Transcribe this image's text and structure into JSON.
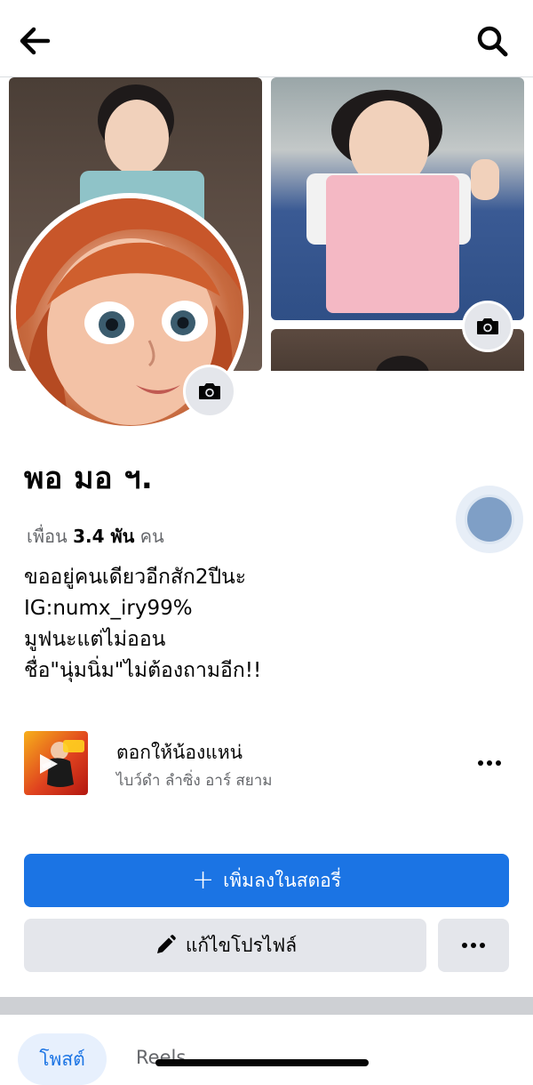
{
  "header": {
    "back_icon": "arrow-left-icon",
    "search_icon": "search-icon"
  },
  "cover": {
    "camera_icon": "camera-icon"
  },
  "profile": {
    "name": "พอ มอ ฯ.",
    "friends_prefix": "เพื่อน",
    "friends_count": "3.4 พัน",
    "friends_suffix": "คน",
    "bio": [
      "ขออยู่คนเดียวอีกสัก2ปีนะ",
      "IG:numx_iry99%",
      "มูฟนะแต่ไม่ออน",
      "ชื่อ\"นุ่มนิ่ม\"ไม่ต้องถามอีก!!"
    ]
  },
  "music": {
    "song": "ตอกให้น้องแหน่",
    "artist": "ไบว์ดำ ลำซิ่ง อาร์ สยาม",
    "play_icon": "play-icon",
    "more_icon": "more-horizontal-icon"
  },
  "actions": {
    "add_story": "เพิ่มลงในสตอรี่",
    "edit_profile": "แก้ไขโปรไฟล์"
  },
  "tabs": {
    "posts": "โพสต์",
    "reels": "Reels"
  },
  "colors": {
    "primary": "#1b74e4",
    "secondary_button": "#e4e6eb",
    "muted_text": "#65676b"
  }
}
